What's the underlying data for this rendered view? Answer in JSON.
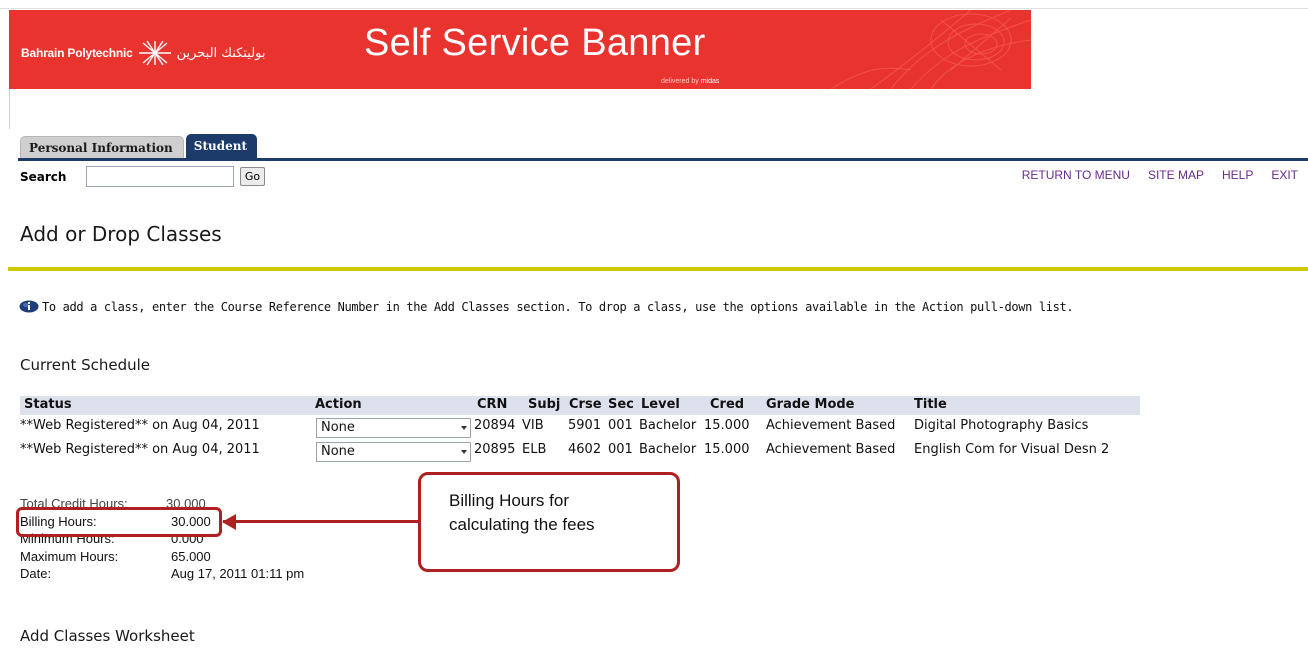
{
  "banner": {
    "logo_en": "Bahrain Polytechnic",
    "logo_ar": "بوليتكنك البحرين",
    "title": "Self Service Banner",
    "delivered_prefix": "delivered by",
    "delivered_brand": "midas"
  },
  "tabs": [
    {
      "label": "Personal Information",
      "active": false
    },
    {
      "label": "Student",
      "active": true
    }
  ],
  "search": {
    "label": "Search",
    "value": "",
    "go_label": "Go"
  },
  "top_nav": [
    {
      "label": "RETURN TO MENU"
    },
    {
      "label": "SITE MAP"
    },
    {
      "label": "HELP"
    },
    {
      "label": "EXIT"
    }
  ],
  "page_title": "Add or Drop Classes",
  "info_text": "To add a class, enter the Course Reference Number in the Add Classes section. To drop a class, use the options available in the Action pull-down list.",
  "current_schedule": {
    "title": "Current Schedule",
    "headers": {
      "status": "Status",
      "action": "Action",
      "crn": "CRN",
      "subj": "Subj",
      "crse": "Crse",
      "sec": "Sec",
      "level": "Level",
      "cred": "Cred",
      "grade_mode": "Grade Mode",
      "title": "Title"
    },
    "rows": [
      {
        "status": "**Web Registered** on Aug 04, 2011",
        "action": "None",
        "crn": "20894",
        "subj": "VIB",
        "crse": "5901",
        "sec": "001",
        "level": "Bachelor",
        "cred": "15.000",
        "grade_mode": "Achievement Based",
        "title": "Digital Photography Basics"
      },
      {
        "status": "**Web Registered** on Aug 04, 2011",
        "action": "None",
        "crn": "20895",
        "subj": "ELB",
        "crse": "4602",
        "sec": "001",
        "level": "Bachelor",
        "cred": "15.000",
        "grade_mode": "Achievement Based",
        "title": "English Com for Visual Desn 2"
      }
    ]
  },
  "hours": {
    "total_credit_label": "Total Credit Hours:",
    "total_credit_value": "30.000",
    "billing_label": "Billing Hours:",
    "billing_value": "30.000",
    "minimum_label": "Minimum Hours:",
    "minimum_value": "0.000",
    "maximum_label": "Maximum Hours:",
    "maximum_value": "65.000",
    "date_label": "Date:",
    "date_value": "Aug 17, 2011 01:11 pm"
  },
  "callout": {
    "line1": "Billing Hours for",
    "line2": "calculating the fees"
  },
  "add_classes_title": "Add Classes Worksheet",
  "colors": {
    "banner_red": "#e8332f",
    "tab_navy": "#1c3b6b",
    "title_rule": "#cfc800",
    "nav_link": "#6a2b8c",
    "annotation_red": "#b02020"
  }
}
